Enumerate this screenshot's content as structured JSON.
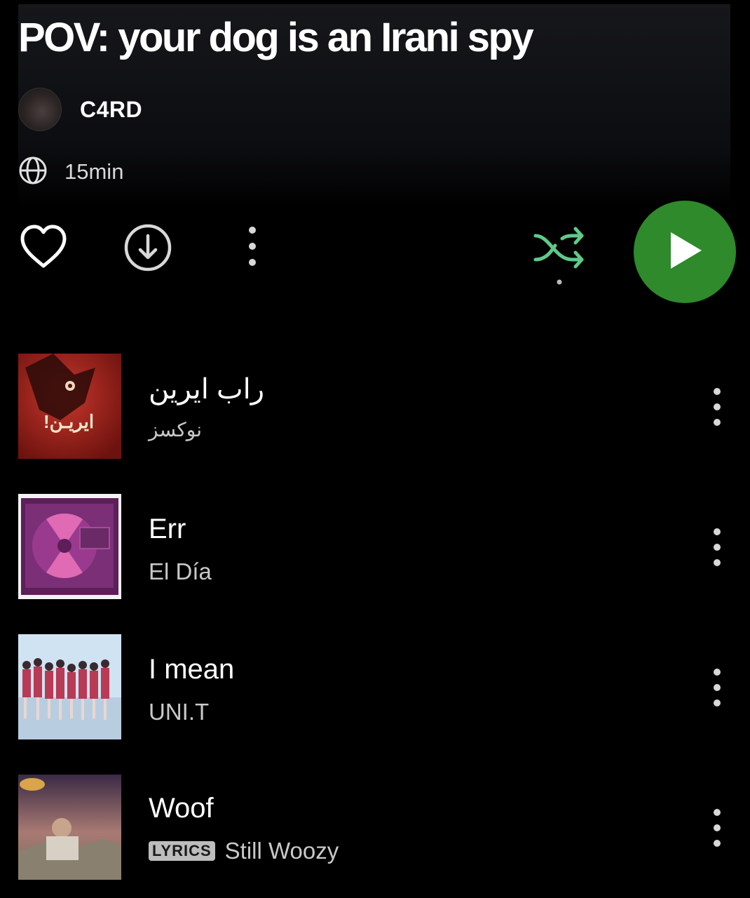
{
  "playlist": {
    "title": "POV: your dog is an Irani spy",
    "owner": "C4RD",
    "duration": "15min",
    "visibility_icon": "globe-icon"
  },
  "controls": {
    "like_icon": "heart-icon",
    "download_icon": "download-icon",
    "more_icon": "more-vertical-icon",
    "shuffle_icon": "shuffle-icon",
    "play_icon": "play-icon",
    "accent_color": "#2e8a2b",
    "shuffle_color": "#5fc98a"
  },
  "tracks": [
    {
      "title": "راب ایرین",
      "artist": "نوکسز",
      "art_text": "ایریـن!"
    },
    {
      "title": "Err",
      "artist": "El Día"
    },
    {
      "title": "I mean",
      "artist": "UNI.T"
    },
    {
      "title": "Woof",
      "artist": "Still Woozy",
      "badge": "LYRICS"
    }
  ]
}
